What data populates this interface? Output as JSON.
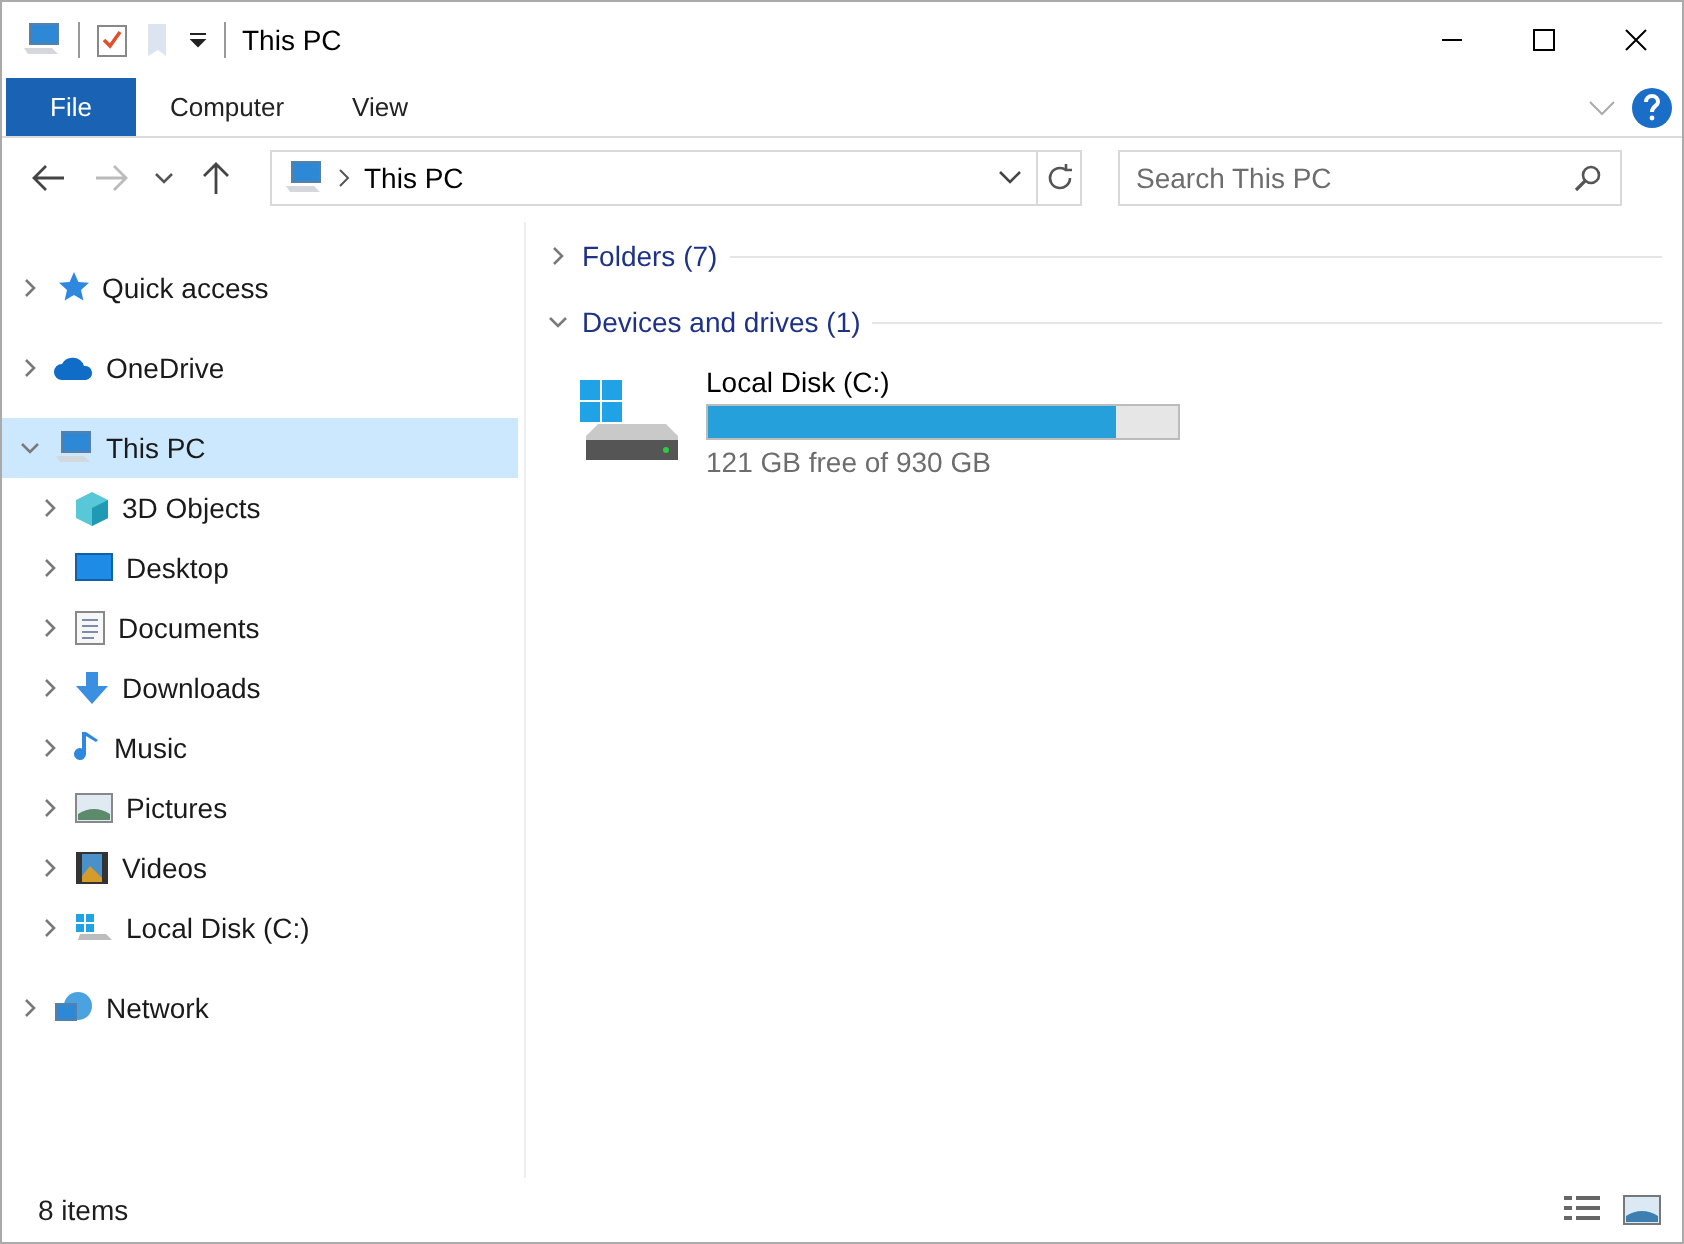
{
  "window": {
    "title": "This PC"
  },
  "ribbon_tabs": [
    {
      "label": "File",
      "selected": true
    },
    {
      "label": "Computer",
      "selected": false
    },
    {
      "label": "View",
      "selected": false
    }
  ],
  "address": {
    "path": "This PC"
  },
  "search": {
    "placeholder": "Search This PC"
  },
  "sidebar": {
    "items": [
      {
        "label": "Quick access",
        "expanded": false,
        "selected": false
      },
      {
        "label": "OneDrive",
        "expanded": false,
        "selected": false
      },
      {
        "label": "This PC",
        "expanded": true,
        "selected": true,
        "children": [
          {
            "label": "3D Objects",
            "expanded": false,
            "selected": false
          },
          {
            "label": "Desktop",
            "expanded": false,
            "selected": false
          },
          {
            "label": "Documents",
            "expanded": false,
            "selected": false
          },
          {
            "label": "Downloads",
            "expanded": false,
            "selected": false
          },
          {
            "label": "Music",
            "expanded": false,
            "selected": false
          },
          {
            "label": "Pictures",
            "expanded": false,
            "selected": false
          },
          {
            "label": "Videos",
            "expanded": false,
            "selected": false
          },
          {
            "label": "Local Disk (C:)",
            "expanded": false,
            "selected": false
          }
        ]
      },
      {
        "label": "Network",
        "expanded": false,
        "selected": false
      }
    ]
  },
  "sections": [
    {
      "title": "Folders (7)",
      "expanded": false
    },
    {
      "title": "Devices and drives (1)",
      "expanded": true,
      "drives": [
        {
          "name": "Local Disk (C:)",
          "level": 0.87,
          "free": "121 GB free of 930 GB"
        }
      ]
    }
  ],
  "status_bar": {
    "count": "8 items"
  }
}
